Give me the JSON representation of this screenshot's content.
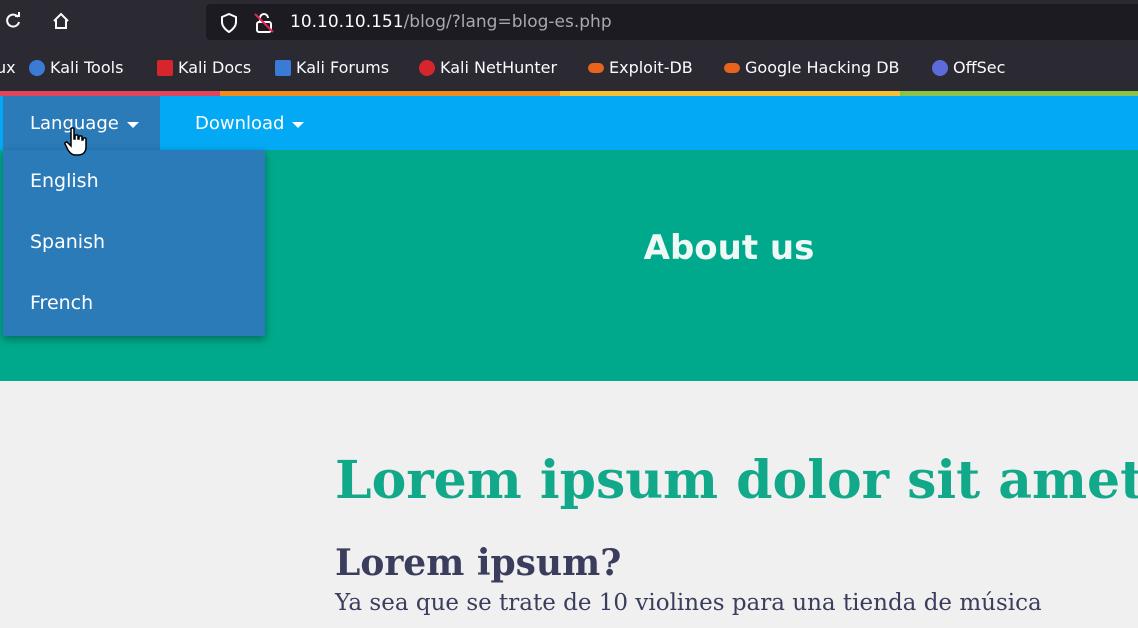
{
  "browser": {
    "url_host": "10.10.10.151",
    "url_path": "/blog/?lang=blog-es.php"
  },
  "bookmarks": [
    {
      "label": "ux",
      "color": "#2b2a33"
    },
    {
      "label": "Kali Tools",
      "color": "#3a7bd5"
    },
    {
      "label": "Kali Docs",
      "color": "#d6252b"
    },
    {
      "label": "Kali Forums",
      "color": "#3a7bd5"
    },
    {
      "label": "Kali NetHunter",
      "color": "#d6252b"
    },
    {
      "label": "Exploit-DB",
      "color": "#e8641c"
    },
    {
      "label": "Google Hacking DB",
      "color": "#e8641c"
    },
    {
      "label": "OffSec",
      "color": "#5b6bd9"
    }
  ],
  "nav": {
    "language": "Language",
    "download": "Download"
  },
  "dropdown": {
    "items": [
      "English",
      "Spanish",
      "French"
    ]
  },
  "hero": {
    "title": "About us"
  },
  "content": {
    "title": "Lorem ipsum dolor sit amet",
    "subtitle": "Lorem ipsum?",
    "paragraph": "Ya sea que se trate de 10 violines para una tienda de música"
  },
  "colors": {
    "nav_bg": "#03a9f4",
    "dropdown_bg": "#2b7bb9",
    "hero_bg": "#00a98b",
    "title_accent": "#12a88a",
    "body_text": "#3a3d5c"
  }
}
